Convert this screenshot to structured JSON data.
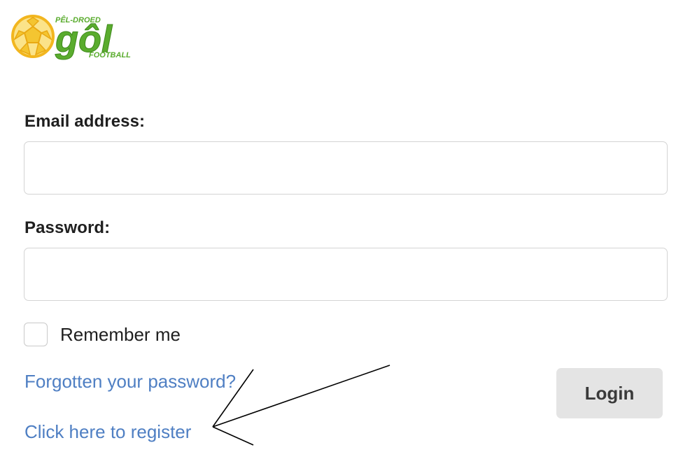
{
  "logo": {
    "top_text": "PÊL-DROED",
    "main_text": "gôl",
    "bottom_text": "FOOTBALL"
  },
  "form": {
    "email_label": "Email address:",
    "email_value": "",
    "password_label": "Password:",
    "password_value": "",
    "remember_label": "Remember me",
    "forgot_link": "Forgotten your password?",
    "register_link": "Click here to register",
    "login_button": "Login"
  },
  "colors": {
    "link": "#4f7fc3",
    "logo_green": "#5aac2e",
    "ball_yellow": "#f4c531",
    "button_bg": "#e4e4e4"
  },
  "annotation": {
    "type": "arrow",
    "points_to": "register-link"
  }
}
